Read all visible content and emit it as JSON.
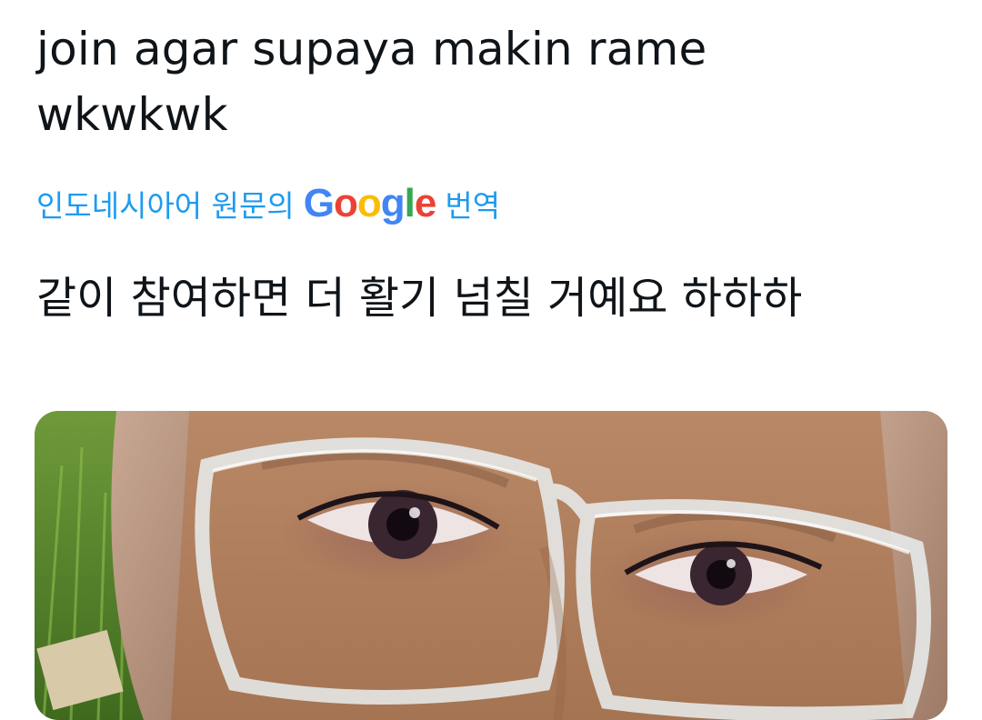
{
  "post": {
    "text": "join agar supaya makin rame wkwkwk"
  },
  "translation": {
    "label_prefix": "인도네시아어 원문의",
    "google_letters": [
      "G",
      "o",
      "o",
      "g",
      "l",
      "e"
    ],
    "label_suffix": "번역",
    "text": "같이 참여하면 더 활기 넘칠 거예요 하하하"
  },
  "colors": {
    "link": "#1d9bf0",
    "text": "#0f1419"
  },
  "media": {
    "icon": "photo"
  }
}
